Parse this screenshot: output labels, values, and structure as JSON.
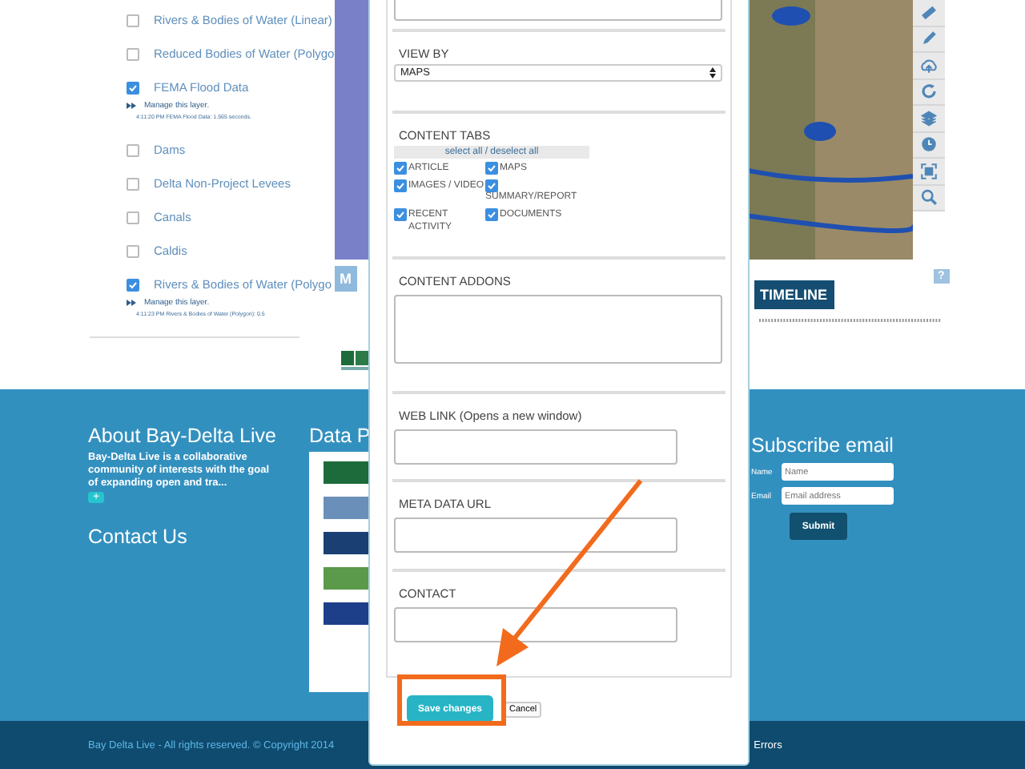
{
  "layers": [
    {
      "label": "Rivers & Bodies of Water (Linear)",
      "checked": false
    },
    {
      "label": "Reduced Bodies of Water (Polygo",
      "checked": false
    },
    {
      "label": "FEMA Flood Data",
      "checked": true,
      "manage_link": "Manage this layer.",
      "load_time": "4:11:20 PM FEMA Flood Data: 1.565 seconds."
    },
    {
      "label": "Dams",
      "checked": false
    },
    {
      "label": "Delta Non-Project Levees",
      "checked": false
    },
    {
      "label": "Canals",
      "checked": false
    },
    {
      "label": "Caldis",
      "checked": false
    },
    {
      "label": "Rivers & Bodies of Water (Polygo",
      "checked": true,
      "manage_link": "Manage this layer.",
      "load_time": "4:11:23 PM Rivers & Bodies of Water (Polygon): 0.5"
    }
  ],
  "map_controls": {
    "left_button": "M",
    "timeline_button": "TIMELINE",
    "help_button": "?"
  },
  "footer": {
    "about": {
      "heading": "About Bay-Delta Live",
      "text": "Bay-Delta Live is a collaborative community of interests with the goal of expanding open and tra...",
      "more_button": "+"
    },
    "contact_heading": "Contact Us",
    "data_heading": "Data P",
    "subscribe": {
      "heading": "Subscribe email",
      "fields": [
        {
          "label": "Name",
          "placeholder": "Name"
        },
        {
          "label": "Email",
          "placeholder": "Email address"
        }
      ],
      "submit": "Submit"
    }
  },
  "bottom_bar": {
    "copyright": "Bay Delta Live - All rights reserved. © Copyright 2014",
    "errors_link": "Errors"
  },
  "modal": {
    "view_by": {
      "label": "VIEW BY",
      "value": "MAPS"
    },
    "content_tabs": {
      "label": "CONTENT TABS",
      "select_all": "select all / deselect all",
      "items": [
        {
          "label": "ARTICLE",
          "checked": true
        },
        {
          "label": "MAPS",
          "checked": true
        },
        {
          "label": "IMAGES / VIDEO",
          "checked": true
        },
        {
          "label": "SUMMARY/REPORT",
          "checked": true
        },
        {
          "label": "RECENT ACTIVITY",
          "checked": true
        },
        {
          "label": "DOCUMENTS",
          "checked": true
        }
      ]
    },
    "addons_label": "CONTENT ADDONS",
    "fields": [
      {
        "label": "WEB LINK (Opens a new window)"
      },
      {
        "label": "META DATA URL"
      },
      {
        "label": "CONTACT"
      }
    ],
    "save_button": "Save changes",
    "cancel_button": "Cancel"
  }
}
